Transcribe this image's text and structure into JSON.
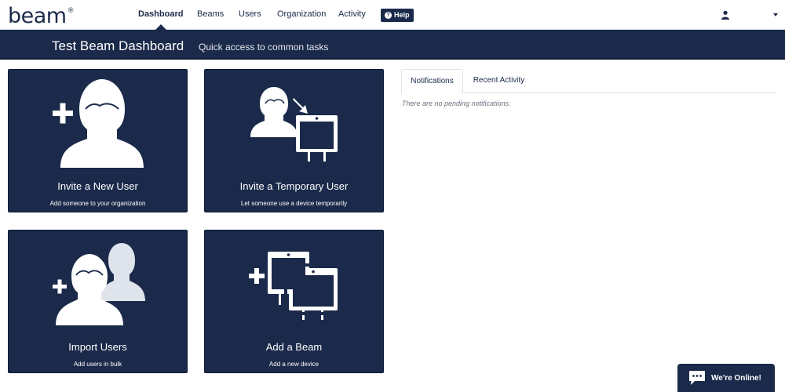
{
  "brand": {
    "logo_text": "beam",
    "logo_mark": "®"
  },
  "nav": {
    "items": [
      {
        "label": "Dashboard",
        "active": true
      },
      {
        "label": "Beams",
        "active": false
      },
      {
        "label": "Users",
        "active": false
      },
      {
        "label": "Organization",
        "active": false
      },
      {
        "label": "Activity",
        "active": false
      }
    ],
    "help_label": "Help",
    "user_icon": "user-icon"
  },
  "header": {
    "title": "Test Beam Dashboard",
    "subtitle": "Quick access to common tasks"
  },
  "tiles": [
    {
      "title": "Invite a New User",
      "description": "Add someone to your organization",
      "icon": "add-user-icon"
    },
    {
      "title": "Invite a Temporary User",
      "description": "Let someone use a device temporarily",
      "icon": "temporary-user-icon"
    },
    {
      "title": "Import Users",
      "description": "Add users in bulk",
      "icon": "import-users-icon"
    },
    {
      "title": "Add a Beam",
      "description": "Add a new device",
      "icon": "add-beam-icon"
    }
  ],
  "panel": {
    "tabs": [
      {
        "label": "Notifications",
        "active": true
      },
      {
        "label": "Recent Activity",
        "active": false
      }
    ],
    "empty_message": "There are no pending notifications."
  },
  "chat": {
    "label": "We're Online!"
  },
  "colors": {
    "navy": "#1b2a4a",
    "white": "#ffffff",
    "muted_text": "#6b7280"
  }
}
